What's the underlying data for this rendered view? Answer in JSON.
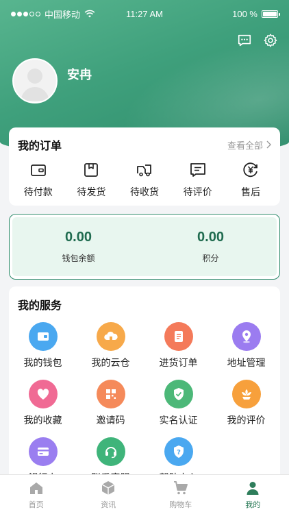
{
  "status_bar": {
    "carrier": "中国移动",
    "time": "11:27 AM",
    "battery": "100 %"
  },
  "profile": {
    "username": "安冉"
  },
  "orders": {
    "title": "我的订单",
    "view_all": "查看全部",
    "items": [
      {
        "label": "待付款",
        "icon": "wallet-icon"
      },
      {
        "label": "待发货",
        "icon": "package-icon"
      },
      {
        "label": "待收货",
        "icon": "truck-icon"
      },
      {
        "label": "待评价",
        "icon": "comment-icon"
      },
      {
        "label": "售后",
        "icon": "yuan-refund-icon"
      }
    ]
  },
  "wallet": {
    "balance_value": "0.00",
    "balance_label": "钱包余额",
    "points_value": "0.00",
    "points_label": "积分"
  },
  "services": {
    "title": "我的服务",
    "items": [
      {
        "label": "我的钱包",
        "icon": "wallet-icon",
        "color": "#4aa8f0"
      },
      {
        "label": "我的云仓",
        "icon": "cloud-house-icon",
        "color": "#f7a94a"
      },
      {
        "label": "进货订单",
        "icon": "document-icon",
        "color": "#f47a5a"
      },
      {
        "label": "地址管理",
        "icon": "location-icon",
        "color": "#9b7cf0"
      },
      {
        "label": "我的收藏",
        "icon": "heart-icon",
        "color": "#f06a94"
      },
      {
        "label": "邀请码",
        "icon": "qr-code-icon",
        "color": "#f58a5a"
      },
      {
        "label": "实名认证",
        "icon": "shield-check-icon",
        "color": "#4cb878"
      },
      {
        "label": "我的评价",
        "icon": "flower-icon",
        "color": "#f7a03c"
      },
      {
        "label": "银行卡",
        "icon": "bank-card-icon",
        "color": "#9a7ef0"
      },
      {
        "label": "联系客服",
        "icon": "headset-icon",
        "color": "#3fb47a"
      },
      {
        "label": "帮助中心",
        "icon": "help-icon",
        "color": "#4aa8f0"
      }
    ]
  },
  "tabbar": {
    "items": [
      {
        "label": "首页",
        "icon": "home-icon",
        "active": false
      },
      {
        "label": "资讯",
        "icon": "cube-icon",
        "active": false
      },
      {
        "label": "购物车",
        "icon": "cart-icon",
        "active": false
      },
      {
        "label": "我的",
        "icon": "user-icon",
        "active": true
      }
    ]
  },
  "colors": {
    "brand": "#2e8c6b",
    "active_tab": "#2e7d5b"
  }
}
